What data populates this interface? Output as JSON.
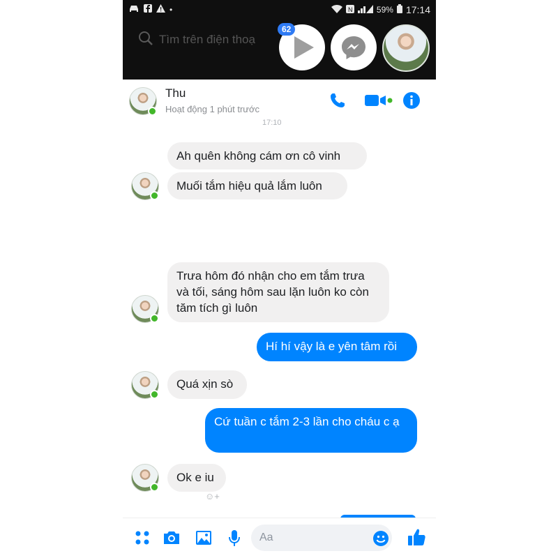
{
  "status_bar": {
    "battery_percent": "59%",
    "time": "17:14",
    "icons": [
      "car-icon",
      "facebook-icon",
      "alert-icon",
      "wifi-icon",
      "nfc-icon",
      "signal-icon",
      "battery-icon"
    ]
  },
  "search": {
    "placeholder": "Tìm trên điện thoạ"
  },
  "chat_heads": {
    "video_badge": "62"
  },
  "conversation": {
    "contact_name": "Thu",
    "contact_status": "Hoạt động 1 phút trước",
    "timestamp": "17:10"
  },
  "messages": [
    {
      "direction": "in",
      "text": "Ah quên không cám ơn cô vinh"
    },
    {
      "direction": "in",
      "text": "Muối tắm hiệu quả lắm luôn"
    },
    {
      "direction": "in",
      "text": "Trưa hôm đó nhận cho em tắm trưa và tối, sáng hôm sau lặn luôn ko còn tăm tích gì luôn"
    },
    {
      "direction": "out",
      "text": "Hí hí vậy là e yên tâm rồi"
    },
    {
      "direction": "in",
      "text": "Quá xịn sò"
    },
    {
      "direction": "out",
      "text": "Cứ tuần c tắm 2-3 lần cho cháu c ạ"
    },
    {
      "direction": "in",
      "text": "Ok e iu"
    }
  ],
  "reaction": "☺+",
  "composer": {
    "placeholder": "Aa"
  },
  "colors": {
    "accent": "#0084ff",
    "incoming_bubble": "#f1f0f0",
    "presence": "#42b72a"
  }
}
